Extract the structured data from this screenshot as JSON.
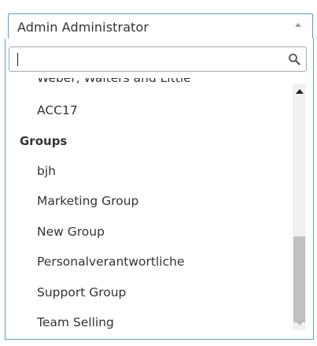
{
  "select": {
    "value": "Admin Administrator"
  },
  "search": {
    "value": "",
    "placeholder": ""
  },
  "list": {
    "partial_item": "Weber, Walters and Little",
    "items_before_group": [
      "ACC17"
    ],
    "group_label": "Groups",
    "group_items": [
      "bjh",
      "Marketing Group",
      "New Group",
      "Personalverantwortliche",
      "Support Group",
      "Team Selling"
    ]
  },
  "scroll": {
    "thumb_start": 0.62,
    "thumb_end": 0.97
  },
  "colors": {
    "focus_border": "#5b9bd5",
    "text": "#333333",
    "scroll_thumb": "#c1c1c1"
  }
}
